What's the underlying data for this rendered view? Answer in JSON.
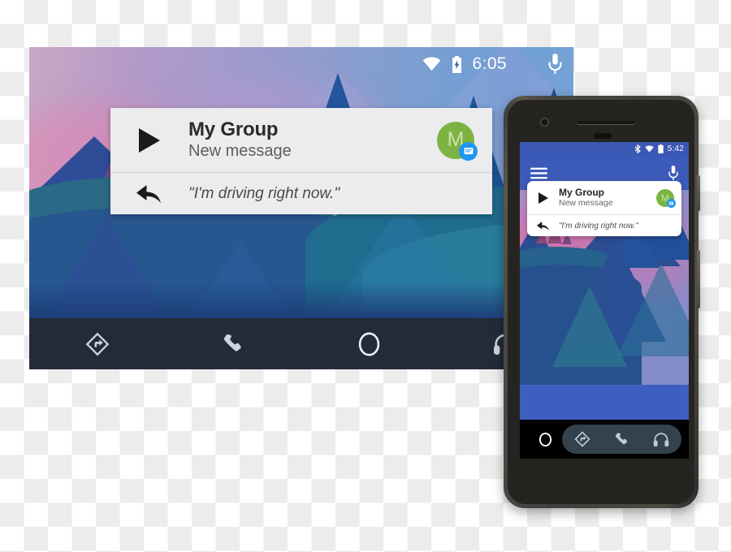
{
  "car_display": {
    "status_bar": {
      "wifi_icon": "wifi-icon",
      "battery_icon": "battery-charging-icon",
      "clock": "6:05",
      "mic_icon": "microphone-icon"
    },
    "notification_card": {
      "play_icon": "play-icon",
      "title": "My Group",
      "subtitle": "New message",
      "avatar_letter": "M",
      "avatar_color": "#7cb342",
      "badge_icon": "message-badge-icon",
      "badge_color": "#2196f3",
      "reply_icon": "reply-arrow-icon",
      "reply_text": "\"I'm driving right now.\""
    },
    "nav_bar": {
      "items": [
        {
          "icon": "navigation-icon",
          "label": "Navigation"
        },
        {
          "icon": "phone-icon",
          "label": "Phone"
        },
        {
          "icon": "home-circle-icon",
          "label": "Home"
        },
        {
          "icon": "headphones-icon",
          "label": "Media"
        }
      ]
    }
  },
  "phone": {
    "status_bar": {
      "bluetooth_icon": "bluetooth-icon",
      "wifi_icon": "wifi-icon",
      "battery_icon": "battery-icon",
      "clock": "5:42"
    },
    "app_bar": {
      "menu_icon": "hamburger-menu-icon",
      "mic_icon": "microphone-icon",
      "color": "#3c5ab8"
    },
    "notification_card": {
      "play_icon": "play-icon",
      "title": "My Group",
      "subtitle": "New message",
      "avatar_letter": "M",
      "badge_icon": "message-badge-icon",
      "reply_icon": "reply-arrow-icon",
      "reply_text": "\"I'm driving right now.\""
    },
    "nav_bar": {
      "home_icon": "home-circle-icon",
      "items": [
        {
          "icon": "navigation-icon",
          "label": "Navigation"
        },
        {
          "icon": "phone-icon",
          "label": "Phone"
        },
        {
          "icon": "headphones-icon",
          "label": "Media"
        }
      ]
    },
    "hardware": {
      "camera": "front-camera",
      "earpiece": "earpiece-speaker",
      "sensor": "proximity-sensor",
      "power_button": "power-button",
      "volume_button": "volume-button"
    }
  }
}
